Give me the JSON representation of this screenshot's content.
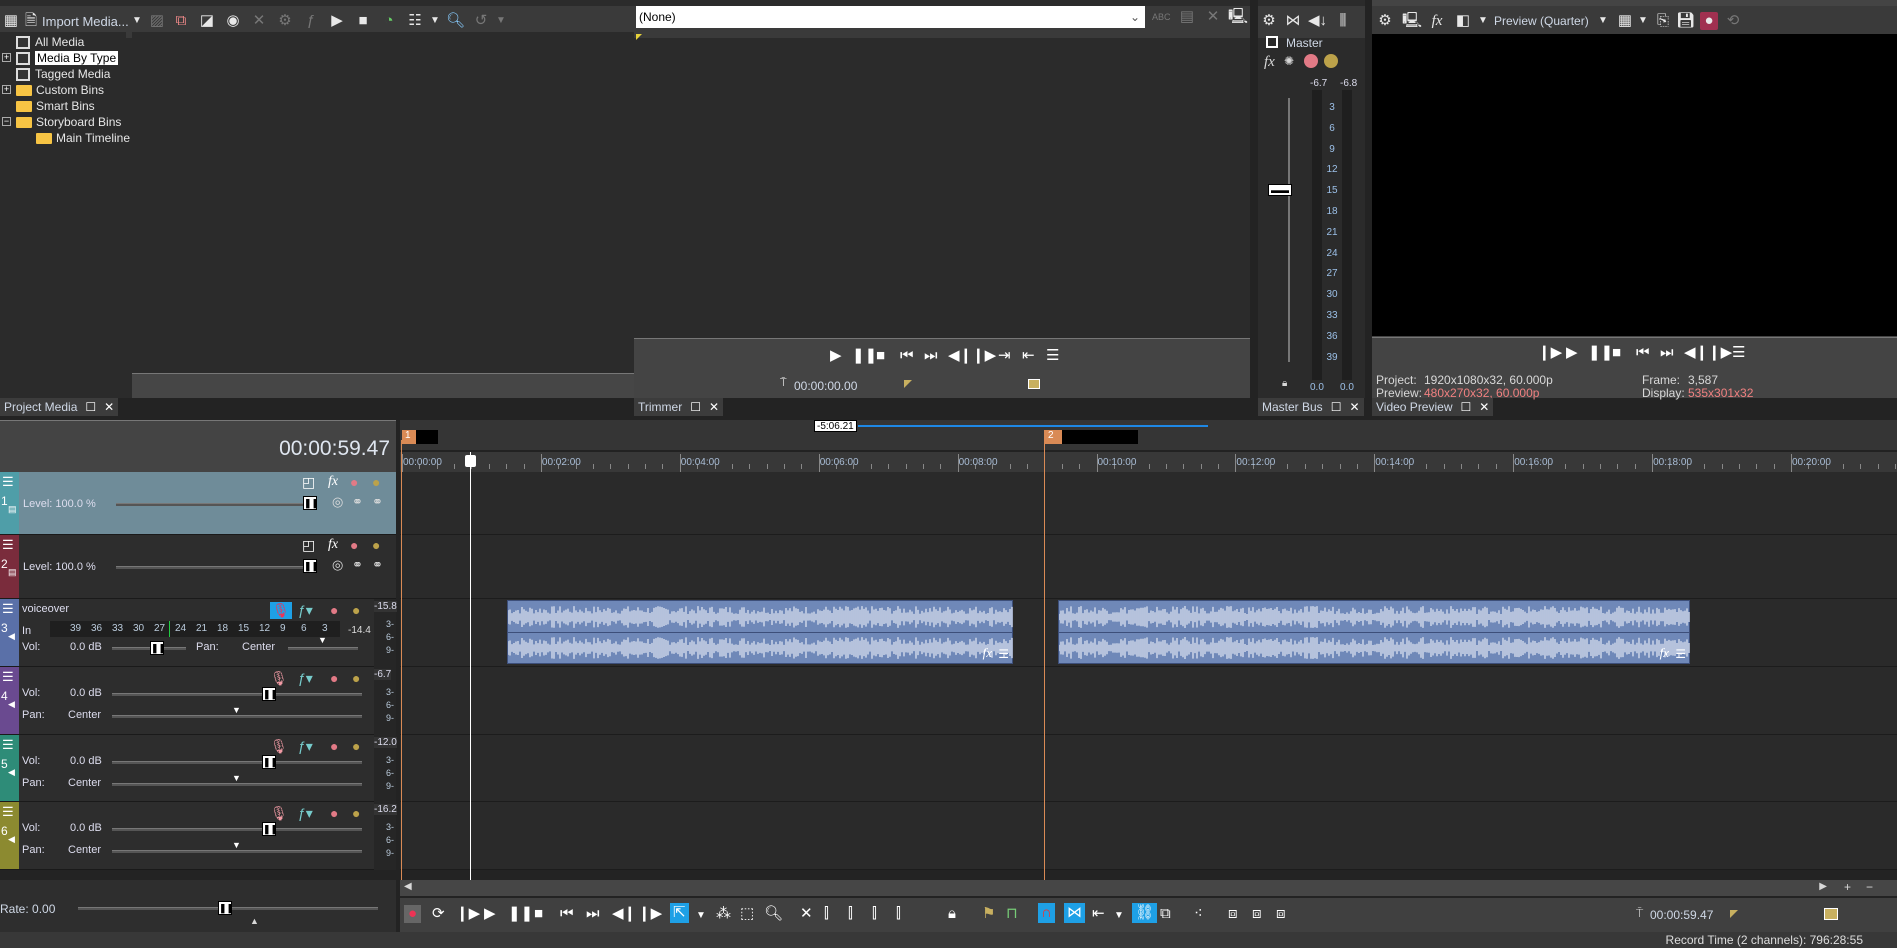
{
  "project_media": {
    "toolbar": {
      "import_label": "Import Media..."
    },
    "tree": [
      {
        "label": "All Media",
        "icon": "bin-icon",
        "expander": ""
      },
      {
        "label": "Media By Type",
        "icon": "bin-icon",
        "expander": "+",
        "selected": true
      },
      {
        "label": "Tagged Media",
        "icon": "bin-icon",
        "expander": ""
      },
      {
        "label": "Custom Bins",
        "icon": "folder-icon",
        "expander": "+"
      },
      {
        "label": "Smart Bins",
        "icon": "folder-icon",
        "expander": ""
      },
      {
        "label": "Storyboard Bins",
        "icon": "folder-icon",
        "expander": "−"
      },
      {
        "label": "Main Timeline",
        "icon": "folder-icon",
        "expander": "",
        "indent": true
      }
    ],
    "tab_label": "Project Media"
  },
  "trimmer": {
    "dropdown_value": "(None)",
    "timecode": "00:00:00.00",
    "tab_label": "Trimmer"
  },
  "master_bus": {
    "title": "Master",
    "peak_left": "-6.7",
    "peak_right": "-6.8",
    "scale": [
      "3",
      "6",
      "9",
      "12",
      "15",
      "18",
      "21",
      "24",
      "27",
      "30",
      "33",
      "36",
      "39"
    ],
    "level_left": "0.0",
    "level_right": "0.0",
    "tab_label": "Master Bus"
  },
  "video_preview": {
    "quality_label": "Preview (Quarter)",
    "project_label": "Project:",
    "project_value": "1920x1080x32, 60.000p",
    "preview_label": "Preview:",
    "preview_value": "480x270x32, 60.000p",
    "frame_label": "Frame:",
    "frame_value": "3,587",
    "display_label": "Display:",
    "display_value": "535x301x32",
    "tab_label": "Video Preview"
  },
  "timeline": {
    "current_time": "00:00:59.47",
    "loop_region_label": "-5:06.21",
    "markers": [
      "1",
      "2"
    ],
    "ruler_labels": [
      "00:00:00",
      "00:02:00",
      "00:04:00",
      "00:06:00",
      "00:08:00",
      "00:10:00",
      "00:12:00",
      "00:14:00",
      "00:16:00",
      "00:18:00",
      "00:20:00"
    ],
    "tracks": [
      {
        "number": "1",
        "type": "video",
        "color": "#4f9ea8",
        "level_label": "Level: 100.0 %",
        "selected": true
      },
      {
        "number": "2",
        "type": "video",
        "color": "#7a2c3c",
        "level_label": "Level: 100.0 %"
      },
      {
        "number": "3",
        "type": "audio",
        "color": "#5a70a8",
        "name": "voiceover",
        "armed": true,
        "in_label": "In",
        "in_scale": [
          "39",
          "36",
          "33",
          "30",
          "27",
          "24",
          "21",
          "18",
          "15",
          "12",
          "9",
          "6",
          "3"
        ],
        "in_peak": "-14.4",
        "vol_label": "Vol:",
        "vol_value": "0.0 dB",
        "pan_label": "Pan:",
        "pan_value": "Center",
        "peak": "-15.8"
      },
      {
        "number": "4",
        "type": "audio",
        "color": "#6a4a90",
        "vol_label": "Vol:",
        "vol_value": "0.0 dB",
        "pan_label": "Pan:",
        "pan_value": "Center",
        "peak": "-6.7"
      },
      {
        "number": "5",
        "type": "audio",
        "color": "#2e8c78",
        "vol_label": "Vol:",
        "vol_value": "0.0 dB",
        "pan_label": "Pan:",
        "pan_value": "Center",
        "peak": "-12.0"
      },
      {
        "number": "6",
        "type": "audio",
        "color": "#8c8a30",
        "vol_label": "Vol:",
        "vol_value": "0.0 dB",
        "pan_label": "Pan:",
        "pan_value": "Center",
        "peak": "-16.2"
      }
    ],
    "track_meter_scale": [
      "3-",
      "6-",
      "9-"
    ],
    "rate_label": "Rate: 0.00",
    "bottom_timecode": "00:00:59.47"
  },
  "status_bar": {
    "record_time": "Record Time (2 channels): 796:28:55"
  },
  "colors": {
    "accent": "#1ea0e6",
    "marker": "#d98a55",
    "audio_clip": "#6f88b8",
    "playhead_line": "#d98a55"
  }
}
